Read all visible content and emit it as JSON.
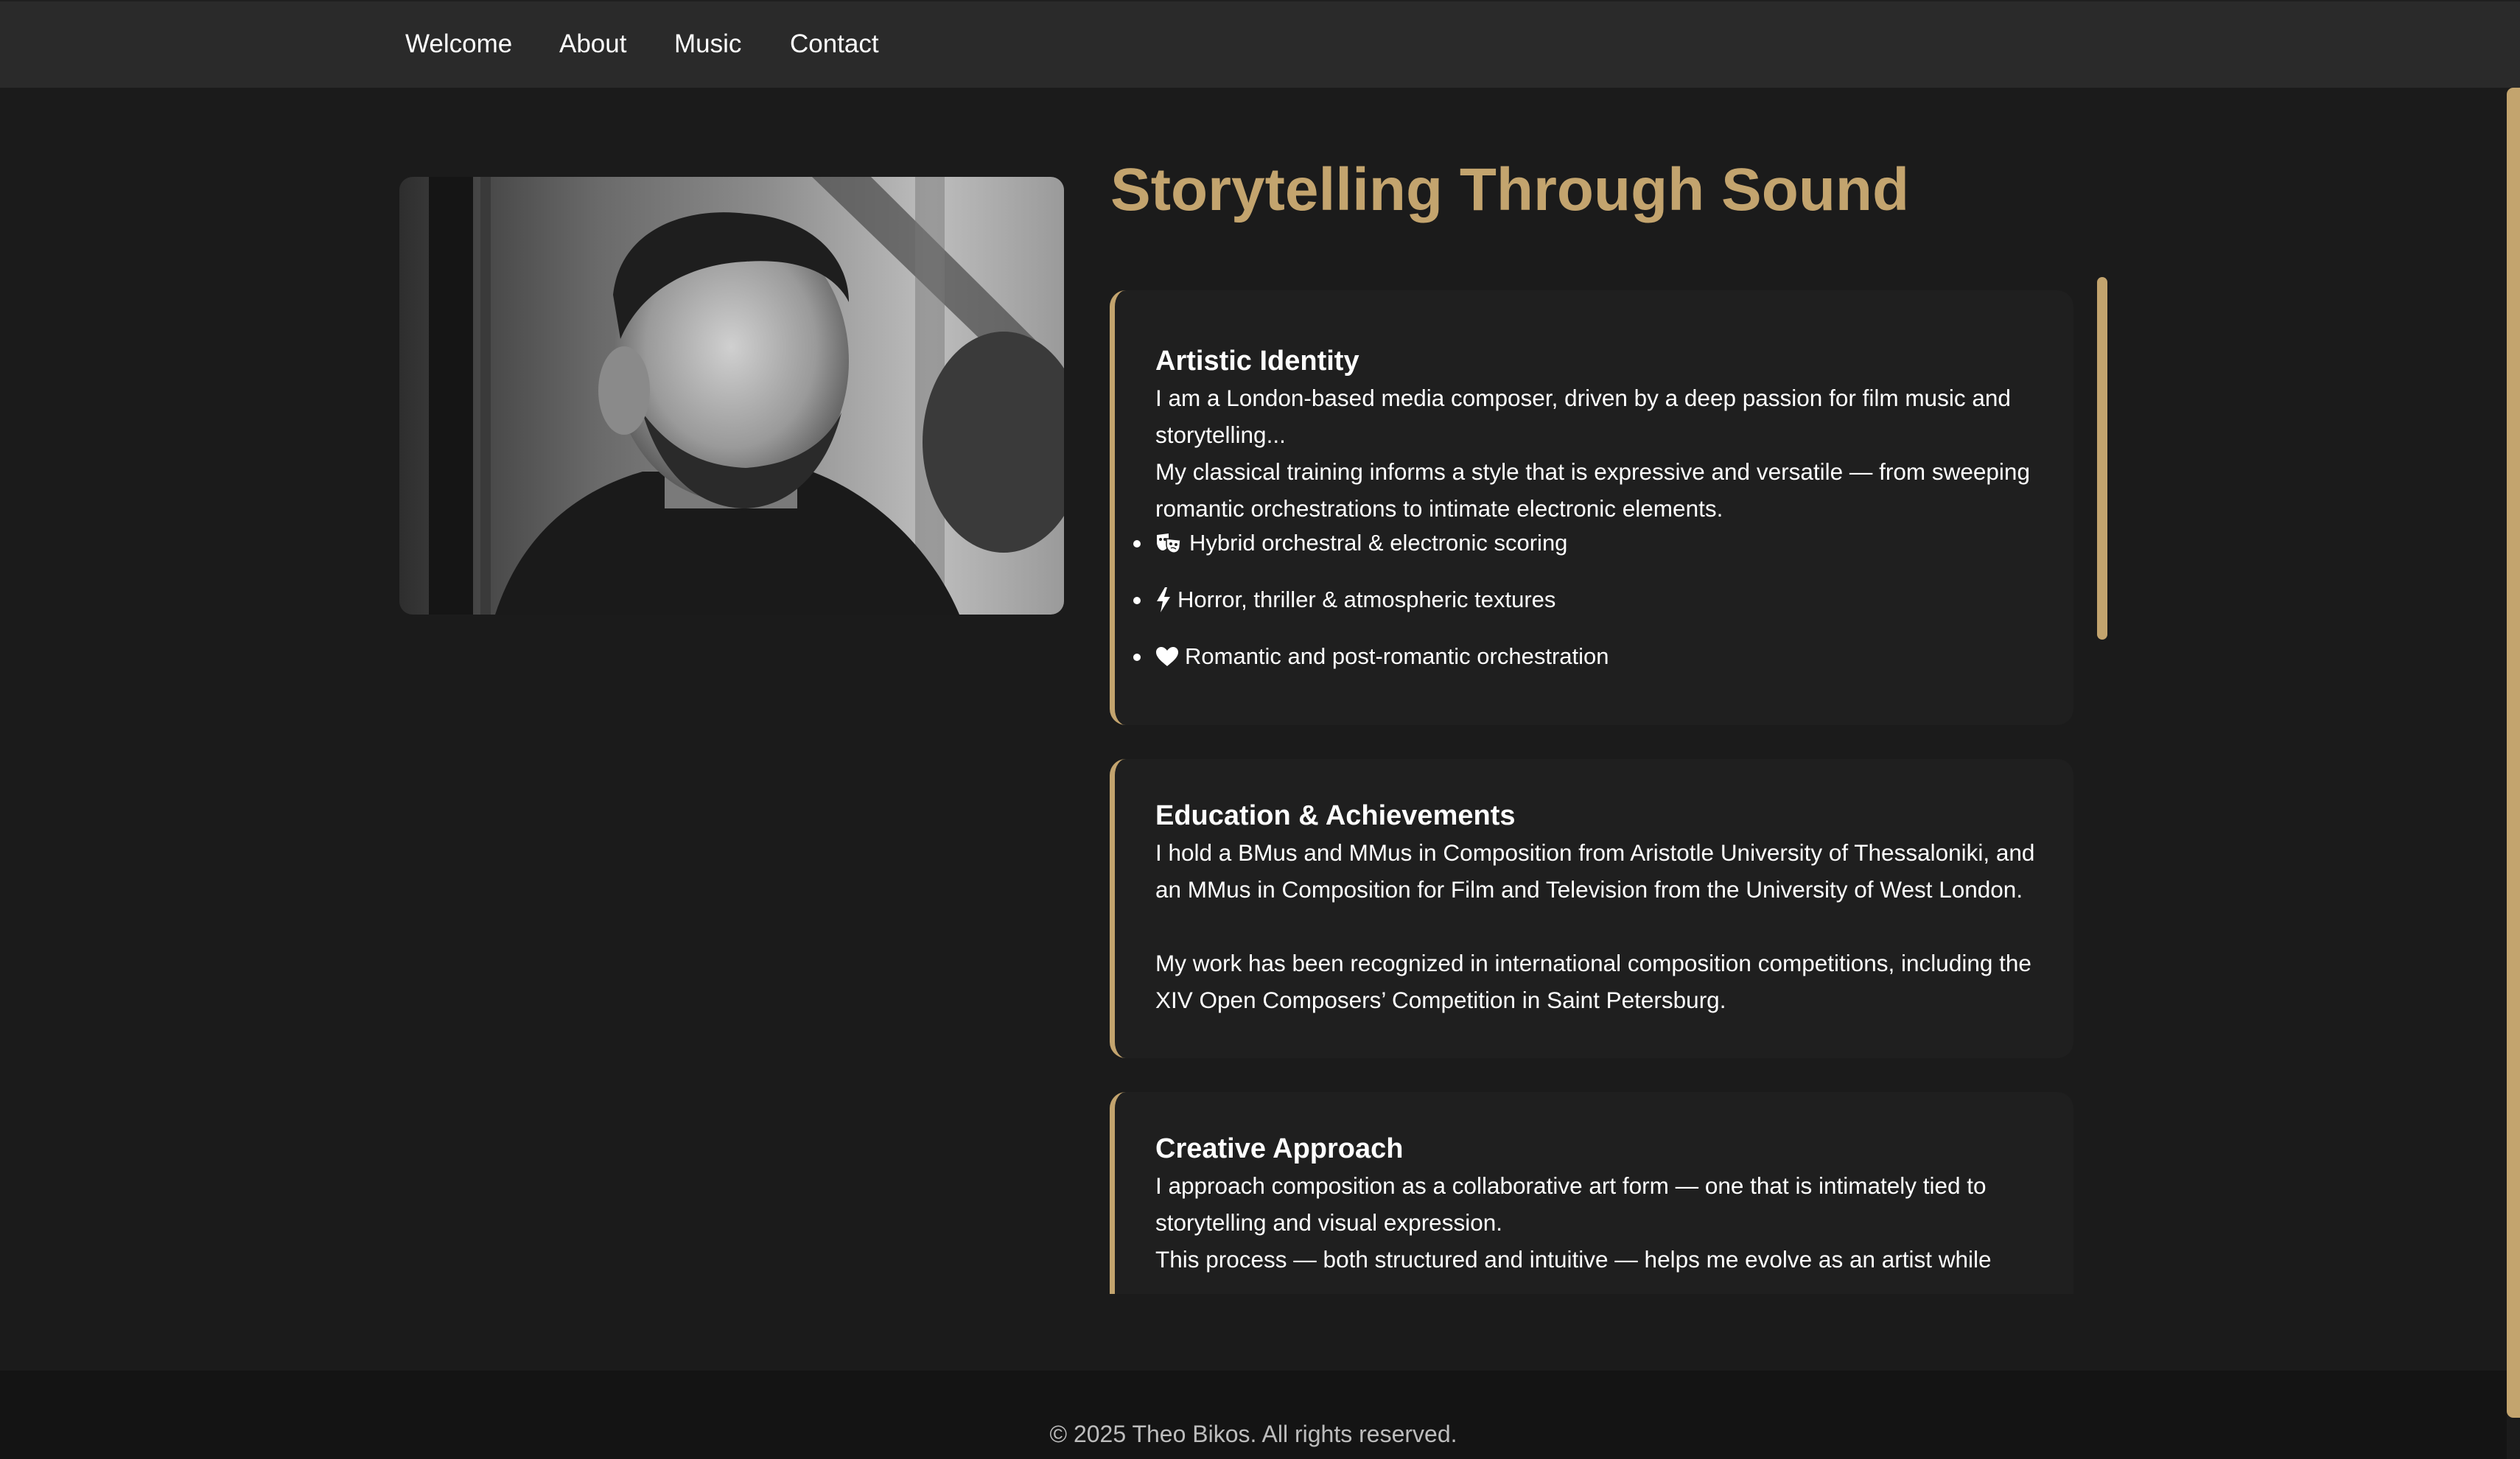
{
  "nav": {
    "items": [
      {
        "label": "Welcome"
      },
      {
        "label": "About"
      },
      {
        "label": "Music"
      },
      {
        "label": "Contact"
      }
    ]
  },
  "main": {
    "title": "Storytelling Through Sound",
    "sections": [
      {
        "heading": "Artistic Identity",
        "paragraphs": [
          "I am a London-based media composer, driven by a deep passion for film music and storytelling...",
          "My classical training informs a style that is expressive and versatile — from sweeping romantic orchestrations to intimate electronic elements."
        ],
        "bullets": [
          {
            "icon": "theater-masks-icon",
            "text": "Hybrid orchestral & electronic scoring"
          },
          {
            "icon": "lightning-bolt-icon",
            "text": "Horror, thriller & atmospheric textures"
          },
          {
            "icon": "heart-icon",
            "text": "Romantic and post-romantic orchestration"
          }
        ]
      },
      {
        "heading": "Education & Achievements",
        "paragraphs": [
          "I hold a BMus and MMus in Composition from Aristotle University of Thessaloniki, and an MMus in Composition for Film and Television from the University of West London.",
          "My work has been recognized in international composition competitions, including the XIV Open Composers’ Competition in Saint Petersburg."
        ]
      },
      {
        "heading": "Creative Approach",
        "paragraphs": [
          "I approach composition as a collaborative art form — one that is intimately tied to storytelling and visual expression.",
          "This process — both structured and intuitive — helps me evolve as an artist while"
        ]
      }
    ]
  },
  "footer": {
    "copyright": "© 2025 Theo Bikos. All rights reserved."
  },
  "colors": {
    "accent": "#c3a46e",
    "background": "#1b1b1b",
    "nav_background": "#2a2a2a",
    "card_background": "#1f1f1f",
    "footer_background": "#141414"
  }
}
